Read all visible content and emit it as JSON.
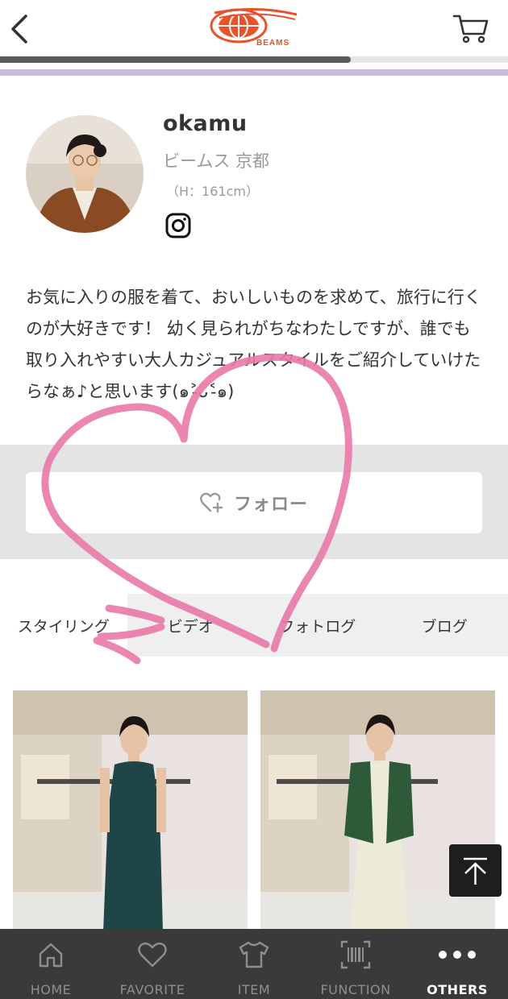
{
  "header": {
    "back_icon": "chevron-left-icon",
    "logo_text": "BEAMS",
    "cart_icon": "cart-icon",
    "scroll_progress_percent": 69
  },
  "profile": {
    "name": "okamu",
    "shop": "ビームス 京都",
    "height": "（H：161cm）",
    "instagram_icon": "instagram-icon",
    "bio": "お気に入りの服を着て、おいしいものを求めて、旅行に行くのが大好きです！ 幼く見られがちなわたしですが、誰でも取り入れやすい大人カジュアルスタイルをご紹介していけたらなぁ♪と思います(๑˃̵ᴗ˂̵๑)"
  },
  "follow": {
    "label": "フォロー",
    "icon": "heart-plus-icon"
  },
  "tabs": [
    {
      "label": "スタイリング",
      "active": true
    },
    {
      "label": "ビデオ",
      "active": false
    },
    {
      "label": "フォトログ",
      "active": false
    },
    {
      "label": "ブログ",
      "active": false
    }
  ],
  "scroll_top_icon": "arrow-up-icon",
  "bottom_nav": [
    {
      "label": "HOME",
      "icon": "home-icon",
      "active": false
    },
    {
      "label": "FAVORITE",
      "icon": "heart-icon",
      "active": false
    },
    {
      "label": "ITEM",
      "icon": "tshirt-icon",
      "active": false
    },
    {
      "label": "FUNCTION",
      "icon": "barcode-icon",
      "active": false
    },
    {
      "label": "OTHERS",
      "icon": "more-dots-icon",
      "active": true
    }
  ],
  "colors": {
    "accent_purple": "#c9bcdc",
    "logo_orange": "#e8522a",
    "doodle_pink": "#e879a7",
    "nav_bg": "#3a3a3a"
  }
}
